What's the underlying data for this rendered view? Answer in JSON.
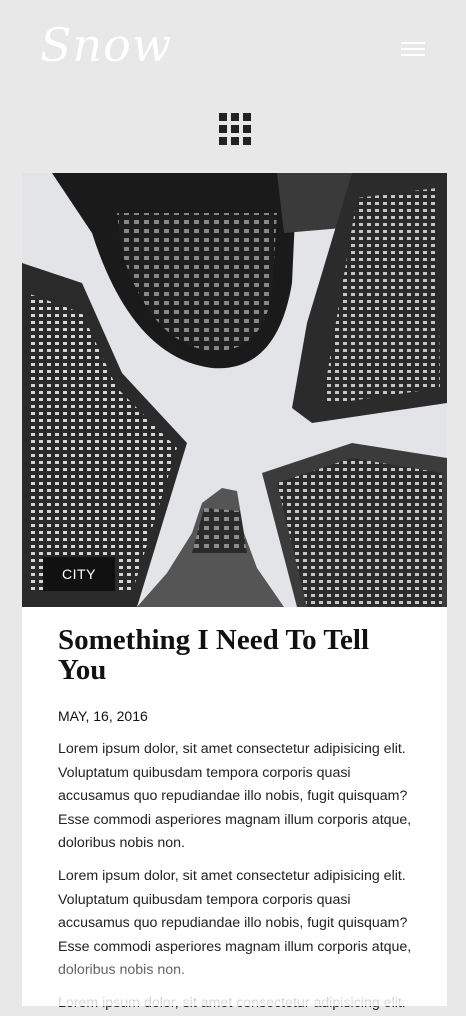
{
  "header": {
    "logo": "Snow",
    "menu_icon": "hamburger-menu-icon",
    "grid_icon": "grid-view-icon"
  },
  "post": {
    "category": "CITY",
    "title": "Something I Need To Tell You",
    "date": "MAY, 16, 2016",
    "paragraphs": [
      "Lorem ipsum dolor, sit amet consectetur adipisicing elit. Voluptatum quibusdam tempora corporis quasi accusamus quo repudiandae illo nobis, fugit quisquam? Esse commodi asperiores magnam illum corporis atque, doloribus nobis non.",
      "Lorem ipsum dolor, sit amet consectetur adipisicing elit. Voluptatum quibusdam tempora corporis quasi accusamus quo repudiandae illo nobis, fugit quisquam? Esse commodi asperiores magnam illum corporis atque, doloribus nobis non.",
      "Lorem ipsum dolor, sit amet consectetur adipisicing elit."
    ]
  },
  "colors": {
    "page_background": "#e8e8e8",
    "card_background": "#ffffff",
    "tag_background": "#111111",
    "text": "#111111"
  }
}
